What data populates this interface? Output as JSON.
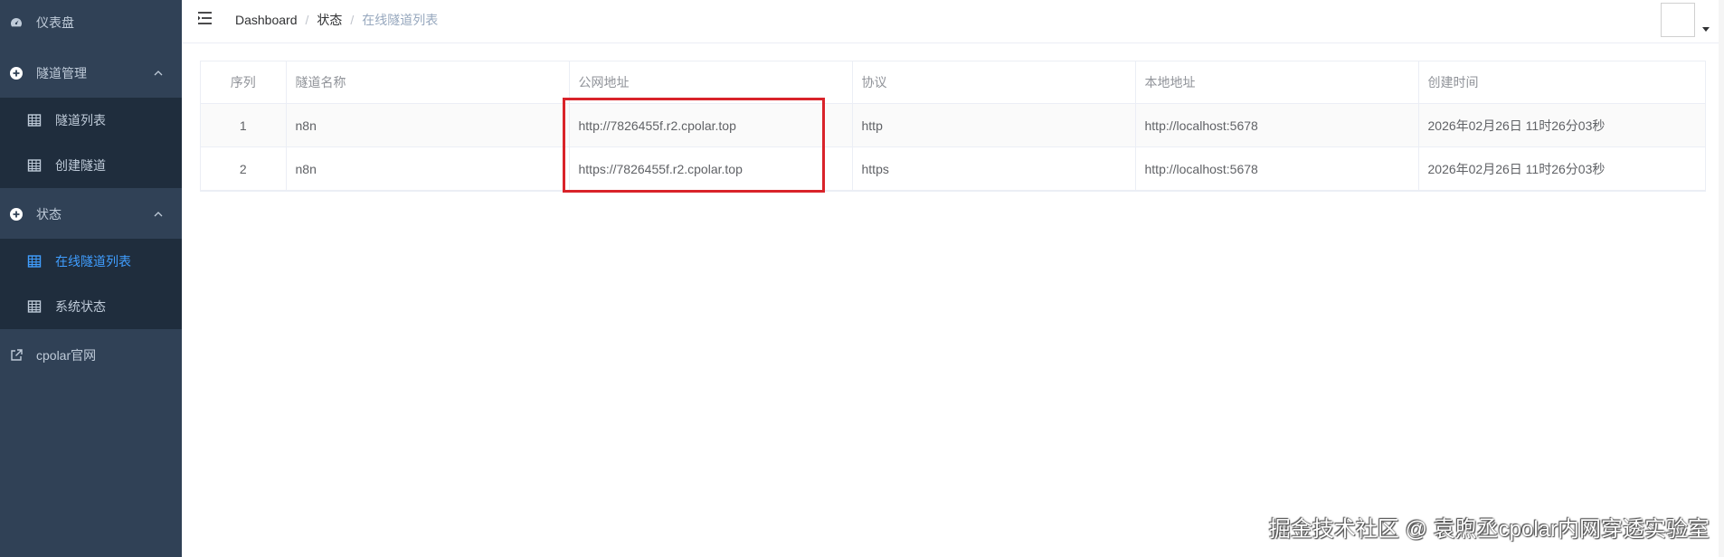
{
  "sidebar": {
    "items": [
      {
        "label": "仪表盘",
        "icon": "dashboard-icon"
      },
      {
        "label": "隧道管理",
        "icon": "plus-circle-icon"
      },
      {
        "label": "隧道列表",
        "icon": "table-icon"
      },
      {
        "label": "创建隧道",
        "icon": "table-icon"
      },
      {
        "label": "状态",
        "icon": "plus-circle-icon"
      },
      {
        "label": "在线隧道列表",
        "icon": "table-icon",
        "active": true
      },
      {
        "label": "系统状态",
        "icon": "table-icon"
      },
      {
        "label": "cpolar官网",
        "icon": "external-link-icon"
      }
    ]
  },
  "breadcrumb": [
    "Dashboard",
    "状态",
    "在线隧道列表"
  ],
  "table": {
    "headers": [
      "序列",
      "隧道名称",
      "公网地址",
      "协议",
      "本地地址",
      "创建时间"
    ],
    "rows": [
      [
        "1",
        "n8n",
        "http://7826455f.r2.cpolar.top",
        "http",
        "http://localhost:5678",
        "2026年02月26日 11时26分03秒"
      ],
      [
        "2",
        "n8n",
        "https://7826455f.r2.cpolar.top",
        "https",
        "http://localhost:5678",
        "2026年02月26日 11时26分03秒"
      ]
    ]
  },
  "watermark": "掘金技术社区 @ 袁煦丞cpolar内网穿透实验室",
  "colors": {
    "sidebar_bg": "#304156",
    "submenu_bg": "#1f2d3d",
    "active": "#409eff",
    "highlight_border": "#d9232a"
  }
}
